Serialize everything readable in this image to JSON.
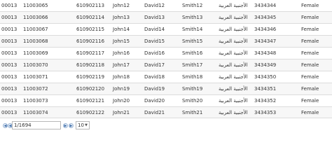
{
  "rows": [
    [
      "00013",
      "11003065",
      "610902113",
      "John12",
      "David12",
      "Smith12",
      "الأجنبية العربية",
      "3434344",
      "Female"
    ],
    [
      "00013",
      "11003066",
      "610902114",
      "John13",
      "David13",
      "Smith13",
      "الأجنبية العربية",
      "3434345",
      "Female"
    ],
    [
      "00013",
      "11003067",
      "610902115",
      "John14",
      "David14",
      "Smith14",
      "الأجنبية العربية",
      "3434346",
      "Female"
    ],
    [
      "00013",
      "11003068",
      "610902116",
      "John15",
      "David15",
      "Smith15",
      "الأجنبية العربية",
      "3434347",
      "Female"
    ],
    [
      "00013",
      "11003069",
      "610902117",
      "John16",
      "David16",
      "Smith16",
      "الأجنبية العربية",
      "3434348",
      "Female"
    ],
    [
      "00013",
      "11003070",
      "610902118",
      "John17",
      "David17",
      "Smith17",
      "الأجنبية العربية",
      "3434349",
      "Female"
    ],
    [
      "00013",
      "11003071",
      "610902119",
      "John18",
      "David18",
      "Smith18",
      "الأجنبية العربية",
      "3434350",
      "Female"
    ],
    [
      "00013",
      "11003072",
      "610902120",
      "John19",
      "David19",
      "Smith19",
      "الأجنبية العربية",
      "3434351",
      "Female"
    ],
    [
      "00013",
      "11003073",
      "610902121",
      "John20",
      "David20",
      "Smith20",
      "الأجنبية العربية",
      "3434352",
      "Female"
    ],
    [
      "00013",
      "11003074",
      "610902122",
      "John21",
      "David21",
      "Smith21",
      "الأجنبية العربية",
      "3434353",
      "Female"
    ]
  ],
  "pager": {
    "page_value": "1/1694",
    "page_size": "10",
    "first_icon": "first-page-icon",
    "prev_icon": "prev-page-icon",
    "next_icon": "next-page-icon",
    "last_icon": "last-page-icon"
  },
  "colors": {
    "row_alt": "#f7f7f7",
    "border": "#dcdcdc",
    "nav_accent": "#3f6ea8"
  }
}
